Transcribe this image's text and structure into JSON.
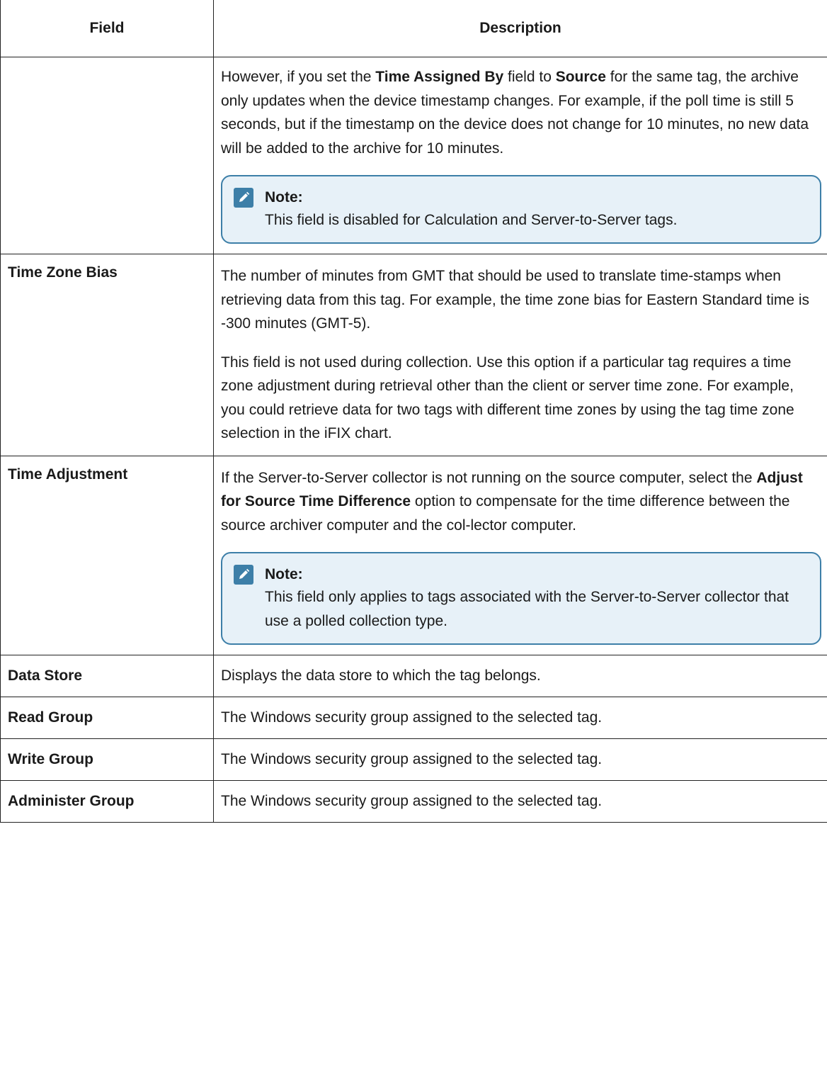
{
  "table": {
    "headers": [
      "Field",
      "Description"
    ],
    "rows": {
      "time_assigned": {
        "field": "",
        "para_pre1": "However, if you set the ",
        "bold1": "Time Assigned By",
        "para_mid1": " field to ",
        "bold2": "Source",
        "para_post1": " for the same tag, the archive only updates when the device timestamp changes. For example, if the poll time is still 5 seconds, but if the timestamp on the device does not change for 10 minutes, no new data will be added to the archive for 10 minutes.",
        "note_label": "Note:",
        "note_text": "This field is disabled for Calculation and Server-to-Server tags."
      },
      "time_zone_bias": {
        "field": "Time Zone Bias",
        "para1": "The number of minutes from GMT that should be used to translate time-stamps when retrieving data from this tag. For example, the time zone bias for Eastern Standard time is -300 minutes (GMT-5).",
        "para2": "This field is not used during collection. Use this option if a particular tag requires a time zone adjustment during retrieval other than the client or server time zone. For example, you could retrieve data for two tags with different time zones by using the tag time zone selection in the iFIX chart."
      },
      "time_adjustment": {
        "field": "Time Adjustment",
        "para_pre": "If the Server-to-Server collector is not running on the source computer, select the ",
        "bold": "Adjust for Source Time Difference",
        "para_post": " option to compensate for the time difference between the source archiver computer and the col-lector computer.",
        "note_label": "Note:",
        "note_text": "This field only applies to tags associated with the Server-to-Server collector that use a polled collection type."
      },
      "data_store": {
        "field": "Data Store",
        "desc": "Displays the data store to which the tag belongs."
      },
      "read_group": {
        "field": "Read Group",
        "desc": "The Windows security group assigned to the selected tag."
      },
      "write_group": {
        "field": "Write Group",
        "desc": "The Windows security group assigned to the selected tag."
      },
      "administer_group": {
        "field": "Administer Group",
        "desc": "The Windows security group assigned to the selected tag."
      }
    }
  },
  "icons": {
    "note": "pencil-icon"
  },
  "colors": {
    "note_border": "#3d7fa8",
    "note_background": "#e7f1f8"
  }
}
